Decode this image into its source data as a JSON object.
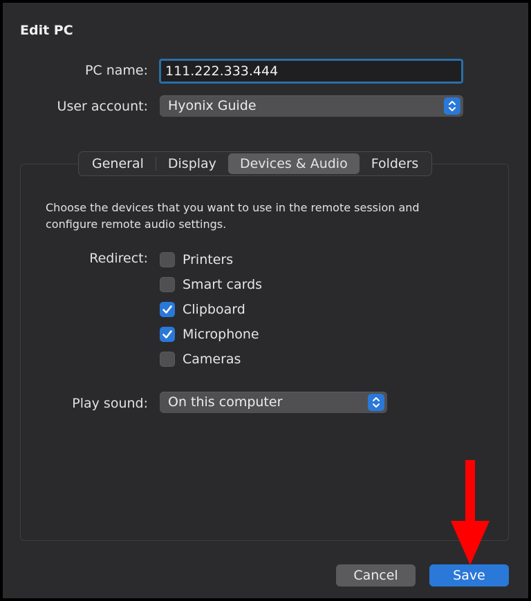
{
  "window": {
    "title": "Edit PC"
  },
  "form": {
    "pc_name_label": "PC name:",
    "pc_name_value": "111.222.333.444",
    "user_account_label": "User account:",
    "user_account_value": "Hyonix Guide"
  },
  "tabs": [
    {
      "label": "General",
      "active": false
    },
    {
      "label": "Display",
      "active": false
    },
    {
      "label": "Devices & Audio",
      "active": true
    },
    {
      "label": "Folders",
      "active": false
    }
  ],
  "devices": {
    "description": "Choose the devices that you want to use in the remote session and configure remote audio settings.",
    "redirect_label": "Redirect:",
    "items": [
      {
        "label": "Printers",
        "checked": false
      },
      {
        "label": "Smart cards",
        "checked": false
      },
      {
        "label": "Clipboard",
        "checked": true
      },
      {
        "label": "Microphone",
        "checked": true
      },
      {
        "label": "Cameras",
        "checked": false
      }
    ],
    "play_sound_label": "Play sound:",
    "play_sound_value": "On this computer"
  },
  "footer": {
    "cancel_label": "Cancel",
    "save_label": "Save"
  },
  "colors": {
    "accent": "#2a78d8",
    "annotation_arrow": "#ff0000",
    "background": "#2b2b2d"
  },
  "icons": {
    "select_chevron": "chevron-up-down-icon",
    "checkbox_check": "checkmark-icon",
    "annotation": "red-arrow-down-icon"
  }
}
